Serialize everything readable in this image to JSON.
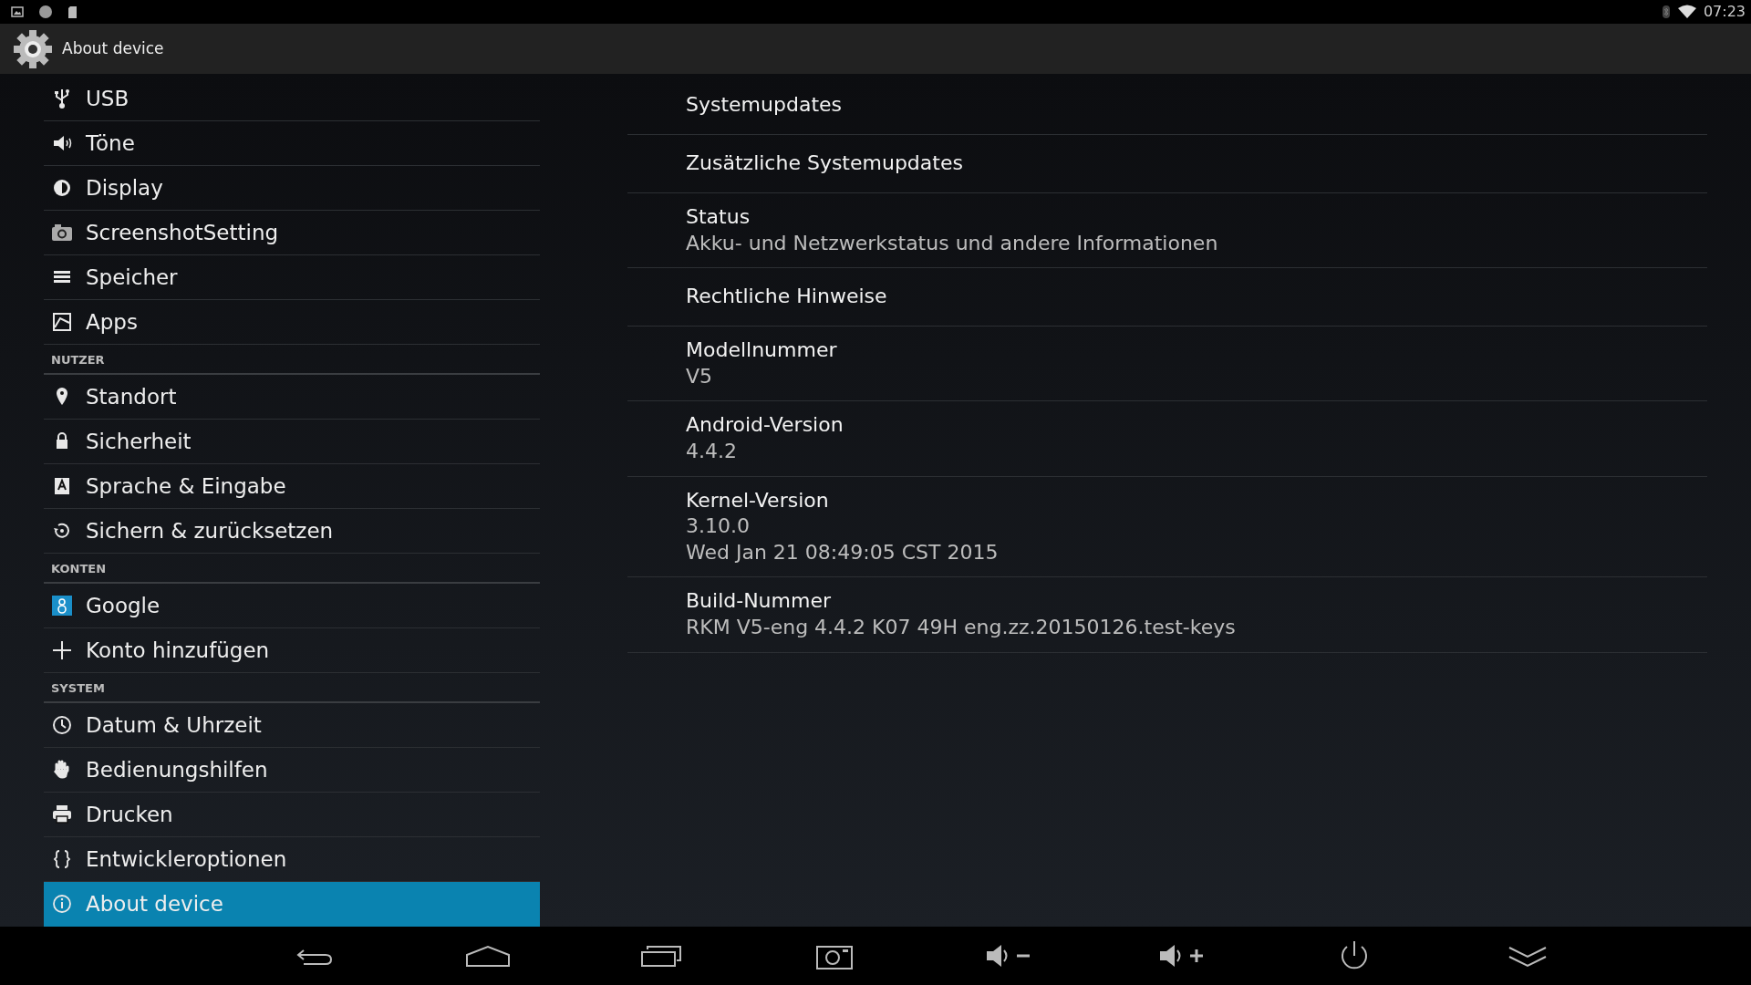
{
  "status_bar": {
    "time": "07:23"
  },
  "action_bar": {
    "title": "About device"
  },
  "sidebar": [
    {
      "kind": "item",
      "label": "USB",
      "selected": false
    },
    {
      "kind": "item",
      "label": "Töne",
      "selected": false
    },
    {
      "kind": "item",
      "label": "Display",
      "selected": false
    },
    {
      "kind": "item",
      "label": "ScreenshotSetting",
      "selected": false
    },
    {
      "kind": "item",
      "label": "Speicher",
      "selected": false
    },
    {
      "kind": "item",
      "label": "Apps",
      "selected": false
    },
    {
      "kind": "header",
      "label": "NUTZER"
    },
    {
      "kind": "item",
      "label": "Standort",
      "selected": false
    },
    {
      "kind": "item",
      "label": "Sicherheit",
      "selected": false
    },
    {
      "kind": "item",
      "label": "Sprache & Eingabe",
      "selected": false
    },
    {
      "kind": "item",
      "label": "Sichern & zurücksetzen",
      "selected": false
    },
    {
      "kind": "header",
      "label": "KONTEN"
    },
    {
      "kind": "item",
      "label": "Google",
      "selected": false
    },
    {
      "kind": "item",
      "label": "Konto hinzufügen",
      "selected": false
    },
    {
      "kind": "header",
      "label": "SYSTEM"
    },
    {
      "kind": "item",
      "label": "Datum & Uhrzeit",
      "selected": false
    },
    {
      "kind": "item",
      "label": "Bedienungshilfen",
      "selected": false
    },
    {
      "kind": "item",
      "label": "Drucken",
      "selected": false
    },
    {
      "kind": "item",
      "label": "Entwickleroptionen",
      "selected": false
    },
    {
      "kind": "item",
      "label": "About device",
      "selected": true
    }
  ],
  "details": [
    {
      "title": "Systemupdates"
    },
    {
      "title": "Zusätzliche Systemupdates"
    },
    {
      "title": "Status",
      "summary": [
        "Akku- und Netzwerkstatus und andere Informationen"
      ]
    },
    {
      "title": "Rechtliche Hinweise"
    },
    {
      "title": "Modellnummer",
      "summary": [
        "V5"
      ]
    },
    {
      "title": "Android-Version",
      "summary": [
        "4.4.2"
      ]
    },
    {
      "title": "Kernel-Version",
      "summary": [
        "3.10.0",
        "Wed Jan 21 08:49:05 CST 2015"
      ]
    },
    {
      "title": "Build-Nummer",
      "summary": [
        "RKM V5-eng 4.4.2 K07 49H eng.zz.20150126.test-keys"
      ]
    }
  ]
}
